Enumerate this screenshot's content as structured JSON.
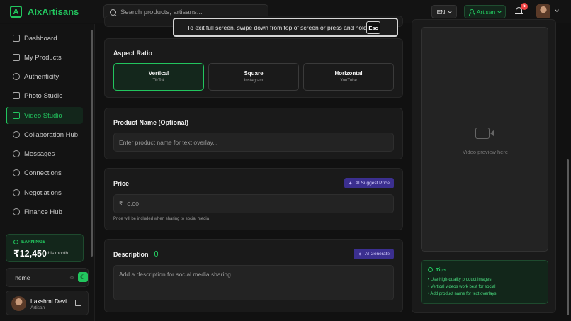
{
  "app": {
    "logo_letter": "A",
    "name": "AIxArtisans"
  },
  "search": {
    "placeholder": "Search products, artisans..."
  },
  "header": {
    "language": "EN",
    "role": "Artisan",
    "notification_count": "5"
  },
  "sidebar": {
    "items": [
      {
        "label": "Dashboard",
        "icon": "home-icon"
      },
      {
        "label": "My Products",
        "icon": "box-icon"
      },
      {
        "label": "Authenticity",
        "icon": "check-circle-icon"
      },
      {
        "label": "Photo Studio",
        "icon": "camera-icon"
      },
      {
        "label": "Video Studio",
        "icon": "video-icon",
        "active": true
      },
      {
        "label": "Collaboration Hub",
        "icon": "users-icon"
      },
      {
        "label": "Messages",
        "icon": "message-icon"
      },
      {
        "label": "Connections",
        "icon": "link-icon"
      },
      {
        "label": "Negotiations",
        "icon": "handshake-icon"
      },
      {
        "label": "Finance Hub",
        "icon": "dollar-icon"
      }
    ],
    "earnings": {
      "label": "EARNINGS",
      "value": "₹12,450",
      "period": "this month"
    },
    "theme": {
      "label": "Theme"
    },
    "profile": {
      "name": "Lakshmi Devi",
      "role": "Artisan"
    }
  },
  "aspect_ratio": {
    "title": "Aspect Ratio",
    "options": [
      {
        "label": "Vertical",
        "sub": "TikTok",
        "selected": true
      },
      {
        "label": "Square",
        "sub": "Instagram"
      },
      {
        "label": "Horizontal",
        "sub": "YouTube"
      }
    ]
  },
  "product_name": {
    "title": "Product Name (Optional)",
    "placeholder": "Enter product name for text overlay..."
  },
  "price": {
    "title": "Price",
    "ai_button": "AI Suggest Price",
    "currency": "₹",
    "placeholder": "0.00",
    "hint": "Price will be included when sharing to social media"
  },
  "description": {
    "title": "Description",
    "ai_button": "AI Generate",
    "placeholder": "Add a description for social media sharing..."
  },
  "preview": {
    "text": "Video preview here"
  },
  "tips": {
    "title": "Tips",
    "items": [
      "• Use high-quality product images",
      "• Vertical videos work best for social",
      "• Add product name for text overlays"
    ]
  },
  "toast": {
    "message": "To exit full screen, swipe down from top of screen or press and hold",
    "key": "Esc"
  },
  "colors": {
    "accent": "#22c55e",
    "ai": "#3b2f8f",
    "badge": "#ef4444",
    "bg": "#111111"
  }
}
